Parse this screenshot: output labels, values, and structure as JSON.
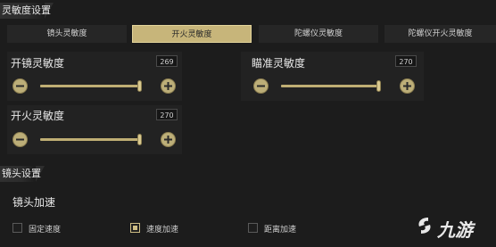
{
  "sections": {
    "sensitivity_title": "灵敏度设置",
    "lens_title": "镜头设置"
  },
  "tabs": [
    {
      "label": "镜头灵敏度",
      "active": false
    },
    {
      "label": "开火灵敏度",
      "active": true
    },
    {
      "label": "陀螺仪灵敏度",
      "active": false
    },
    {
      "label": "陀螺仪开火灵敏度",
      "active": false
    }
  ],
  "sliders": {
    "scope_sensitivity": {
      "label": "开镜灵敏度",
      "value": "269"
    },
    "aim_sensitivity": {
      "label": "瞄准灵敏度",
      "value": "270"
    },
    "fire_sensitivity": {
      "label": "开火灵敏度",
      "value": "270"
    }
  },
  "lens": {
    "accel_label": "镜头加速",
    "options": [
      {
        "label": "固定速度",
        "checked": false
      },
      {
        "label": "速度加速",
        "checked": true
      },
      {
        "label": "距离加速",
        "checked": false
      }
    ]
  },
  "watermark": {
    "text": "九游"
  },
  "colors": {
    "accent": "#c7b57a",
    "background": "#1c1c1c"
  },
  "icons": {
    "decrease": "minus-circle-icon",
    "increase": "plus-circle-icon"
  }
}
